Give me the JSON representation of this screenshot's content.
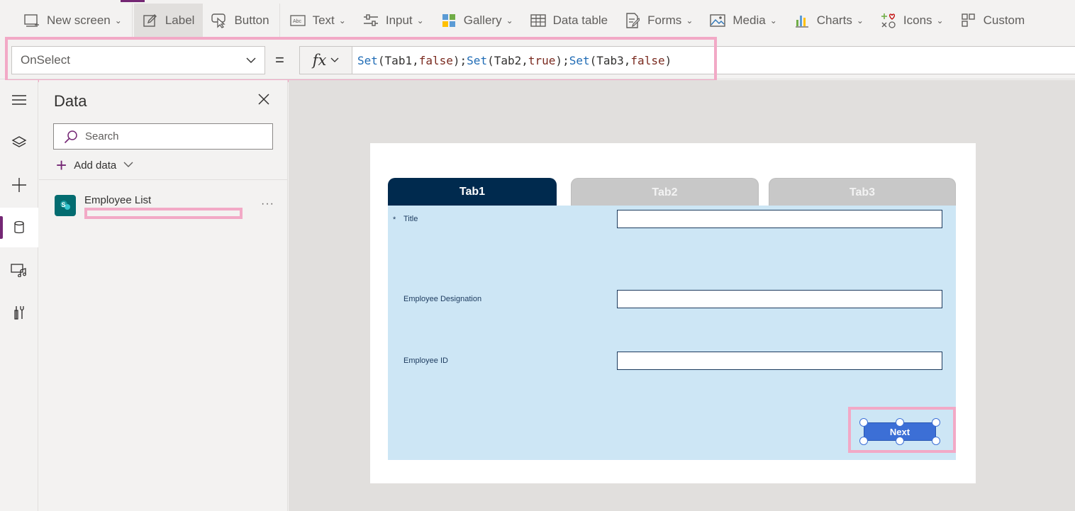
{
  "ribbon": {
    "items": [
      {
        "label": "New screen",
        "icon": "new-screen-icon",
        "dropdown": true
      },
      {
        "label": "Label",
        "icon": "label-edit-icon",
        "dropdown": false
      },
      {
        "label": "Button",
        "icon": "button-cursor-icon",
        "dropdown": false
      },
      {
        "label": "Text",
        "icon": "text-box-icon",
        "dropdown": true
      },
      {
        "label": "Input",
        "icon": "input-sliders-icon",
        "dropdown": true
      },
      {
        "label": "Gallery",
        "icon": "gallery-icon",
        "dropdown": true
      },
      {
        "label": "Data table",
        "icon": "data-table-icon",
        "dropdown": false
      },
      {
        "label": "Forms",
        "icon": "forms-icon",
        "dropdown": true
      },
      {
        "label": "Media",
        "icon": "media-icon",
        "dropdown": true
      },
      {
        "label": "Charts",
        "icon": "charts-icon",
        "dropdown": true
      },
      {
        "label": "Icons",
        "icon": "icons-icon",
        "dropdown": true
      },
      {
        "label": "Custom",
        "icon": "custom-icon",
        "dropdown": false
      }
    ],
    "accent_color": "#742774"
  },
  "formula_bar": {
    "property": "OnSelect",
    "equals": "=",
    "fx": "fx",
    "formula_tokens": [
      {
        "t": "Set",
        "k": "fn"
      },
      {
        "t": "(",
        "k": "id"
      },
      {
        "t": "Tab1",
        "k": "id"
      },
      {
        "t": ",",
        "k": "id"
      },
      {
        "t": "false",
        "k": "kw"
      },
      {
        "t": ")",
        "k": "id"
      },
      {
        "t": ";",
        "k": "id"
      },
      {
        "t": "Set",
        "k": "fn"
      },
      {
        "t": "(",
        "k": "id"
      },
      {
        "t": "Tab2",
        "k": "id"
      },
      {
        "t": ",",
        "k": "id"
      },
      {
        "t": "true",
        "k": "kw"
      },
      {
        "t": ")",
        "k": "id"
      },
      {
        "t": ";",
        "k": "id"
      },
      {
        "t": "Set",
        "k": "fn"
      },
      {
        "t": "(",
        "k": "id"
      },
      {
        "t": "Tab3",
        "k": "id"
      },
      {
        "t": ",",
        "k": "id"
      },
      {
        "t": "false",
        "k": "kw"
      },
      {
        "t": ")",
        "k": "id"
      }
    ]
  },
  "rail": {
    "items": [
      "hamburger-menu-icon",
      "layers-icon",
      "insert-plus-icon",
      "database-icon",
      "media-library-icon",
      "tools-icon"
    ],
    "active_index": 3
  },
  "data_pane": {
    "title": "Data",
    "search_placeholder": "Search",
    "add_data_label": "Add data",
    "sources": [
      {
        "name": "Employee List",
        "icon": "sharepoint-icon",
        "more": "···"
      }
    ]
  },
  "canvas": {
    "tabs": [
      {
        "label": "Tab1",
        "active": true
      },
      {
        "label": "Tab2",
        "active": false
      },
      {
        "label": "Tab3",
        "active": false
      }
    ],
    "fields": [
      {
        "label": "Title",
        "required": true,
        "value": ""
      },
      {
        "label": "Employee Designation",
        "required": false,
        "value": ""
      },
      {
        "label": "Employee ID",
        "required": false,
        "value": ""
      }
    ],
    "required_marker": "*",
    "next_button_label": "Next",
    "active_tab_color": "#002a4e",
    "form_background": "#cde6f5",
    "button_color": "#3c6fd6"
  },
  "annotation_color": "#f2a9c6"
}
